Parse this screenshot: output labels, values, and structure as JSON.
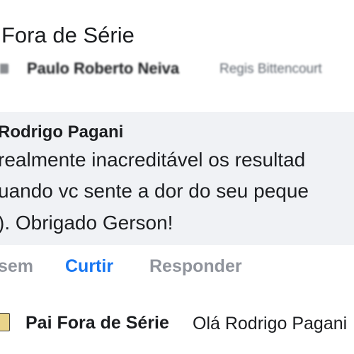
{
  "header": {
    "title": "Fora de Série"
  },
  "previous_comment": {
    "author": "Paulo Roberto Neiva",
    "text": "Regis Bittencourt"
  },
  "comment": {
    "author": "Rodrigo Pagani",
    "lines": [
      "realmente inacreditável os resultad",
      "uando vc sente a dor do seu peque",
      "). Obrigado Gerson!"
    ]
  },
  "actions": {
    "time": "sem",
    "like": "Curtir",
    "reply": "Responder"
  },
  "reply": {
    "author": "Pai Fora de Série",
    "text": "Olá Rodrigo Pagani"
  },
  "colors": {
    "link": "#1877f2",
    "bubble": "#f0f2f5",
    "muted": "#90949c"
  }
}
